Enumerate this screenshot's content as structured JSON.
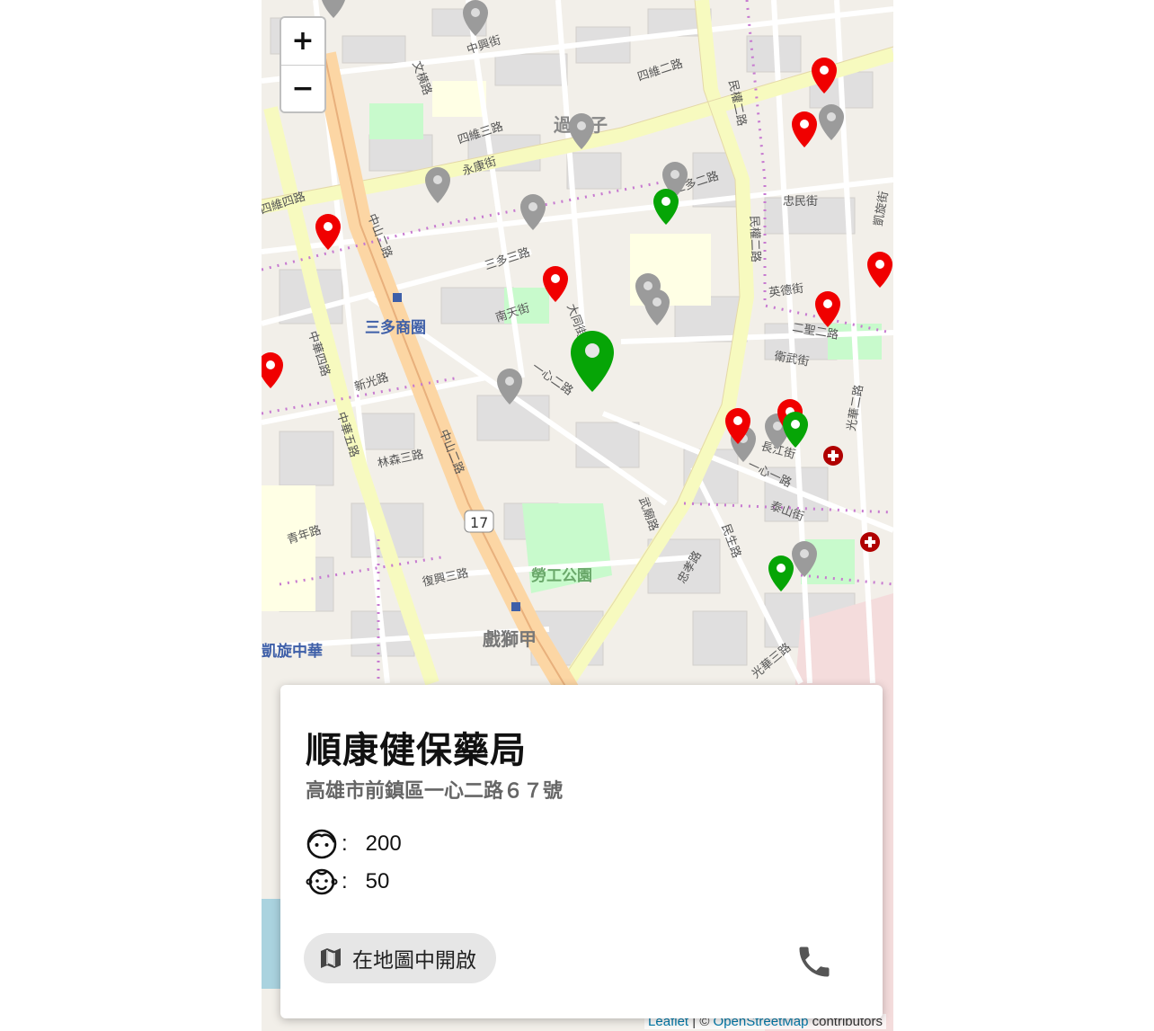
{
  "map": {
    "zoom_in": "+",
    "zoom_out": "−",
    "highlight_labels": [
      "三多商圈",
      "勞工公園",
      "戲獅甲",
      "凱旋中華",
      "過田子"
    ],
    "street_labels": [
      "四維四路",
      "四維三路",
      "四維二路",
      "中山二路",
      "中山二路",
      "中華四路",
      "中華五路",
      "民權二路",
      "民權二路",
      "一心二路",
      "一心一路",
      "三多三路",
      "三多二路",
      "新光路",
      "復興三路",
      "林森三路",
      "光華二路",
      "光華三路",
      "中興街",
      "永康街",
      "南天街",
      "大同街",
      "武廟路",
      "衛武街",
      "二聖二路",
      "英德街",
      "忠民街",
      "凱旋街",
      "泰山街",
      "民生路",
      "青年路",
      "長江街",
      "忠孝路",
      "文横路"
    ],
    "route_shield": "17",
    "marker_colors": {
      "red": "#f00000",
      "green": "#06a506",
      "grey": "#9b9b9b"
    },
    "attribution": {
      "leaflet": "Leaflet",
      "sep": " | © ",
      "osm": "OpenStreetMap",
      "suffix": " contributors"
    }
  },
  "card": {
    "title": "順康健保藥局",
    "address": "高雄市前鎮區一心二路６７號",
    "adult_icon": "face-icon",
    "adult_count": "200",
    "child_icon": "child-face-icon",
    "child_count": "50",
    "colon": ":",
    "open_map_label": "在地圖中開啟",
    "open_map_icon": "map-icon",
    "phone_icon": "phone-icon"
  }
}
